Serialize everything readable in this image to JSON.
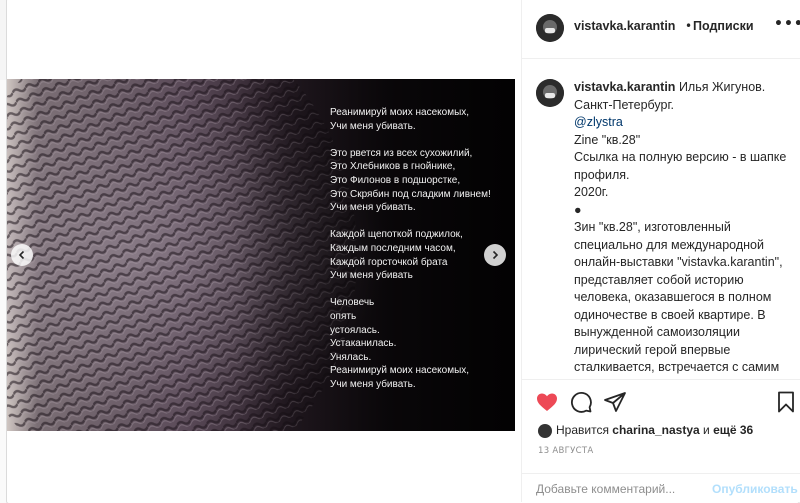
{
  "header": {
    "username": "vistavka.karantin",
    "separator": "•",
    "follow_label": "Подписки",
    "more": "•••"
  },
  "media": {
    "poem": "Реанимируй моих насекомых,\nУчи меня убивать.\n\nЭто рвется из всех сухожилий,\nЭто Хлебников в гнойнике,\nЭто Филонов в подшорстке,\nЭто Скрябин под сладким ливнем!\nУчи меня убивать.\n\nКаждой щепоткой поджилок,\nКаждым последним часом,\nКаждой горсточкой брата\nУчи меня убивать\n\nЧеловечь\nопять\nустоялась.\nУстаканилась.\nУнялась.\nРеанимируй моих насекомых,\nУчи меня убивать."
  },
  "caption": {
    "username": "vistavka.karantin",
    "line1": "Илья Жигунов.",
    "line2": "Санкт-Петербург.",
    "mention": "@zlystra",
    "line3": "Zine \"кв.28\"",
    "line4": "Ссылка на полную версию - в шапке профиля.",
    "line5": "2020г.",
    "bullet": "●",
    "body": "Зин \"кв.28\", изготовленный специально для международной онлайн-выставки \"vistavka.karantin\", представляет собой историю человека, оказавшегося в полном одиночестве в своей квартире. В вынужденной самоизоляции лирический герой впервые сталкивается, встречается с самим собой. Эта встреча вскрывает в нём глубоко спрятанные переживания,"
  },
  "likes": {
    "prefix": "Нравится",
    "user": "charina_nastya",
    "conj": "и",
    "rest": "ещё 36"
  },
  "date": "13 АВГУСТА",
  "comment": {
    "placeholder": "Добавьте комментарий...",
    "publish_label": "Опубликовать"
  },
  "colors": {
    "like_red": "#ed4956",
    "link": "#00376b",
    "publish_disabled": "#b2dffc"
  }
}
